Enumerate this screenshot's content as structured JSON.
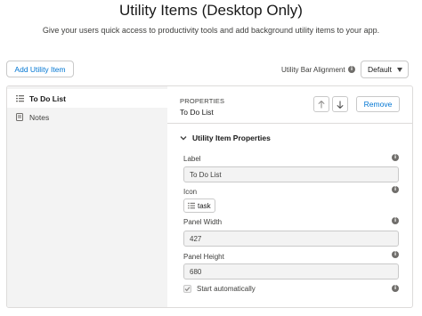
{
  "page": {
    "title": "Utility Items (Desktop Only)",
    "subtitle": "Give your users quick access to productivity tools and add background utility items to your app."
  },
  "toolbar": {
    "add_label": "Add Utility Item",
    "alignment_label": "Utility Bar Alignment",
    "alignment_value": "Default"
  },
  "sidebar": {
    "items": [
      {
        "label": "To Do List",
        "icon": "task-list-icon",
        "active": true
      },
      {
        "label": "Notes",
        "icon": "note-icon",
        "active": false
      }
    ]
  },
  "properties": {
    "caption": "PROPERTIES",
    "name": "To Do List",
    "remove_label": "Remove",
    "section_title": "Utility Item Properties",
    "fields": {
      "label": {
        "label": "Label",
        "value": "To Do List"
      },
      "icon": {
        "label": "Icon",
        "value": "task"
      },
      "panel_width": {
        "label": "Panel Width",
        "value": "427"
      },
      "panel_height": {
        "label": "Panel Height",
        "value": "680"
      }
    },
    "start_automatically": {
      "label": "Start automatically",
      "checked": true
    }
  },
  "colors": {
    "brand": "#0176d3",
    "sidebar_bg": "#f3f3f3",
    "border": "#dddbda"
  }
}
